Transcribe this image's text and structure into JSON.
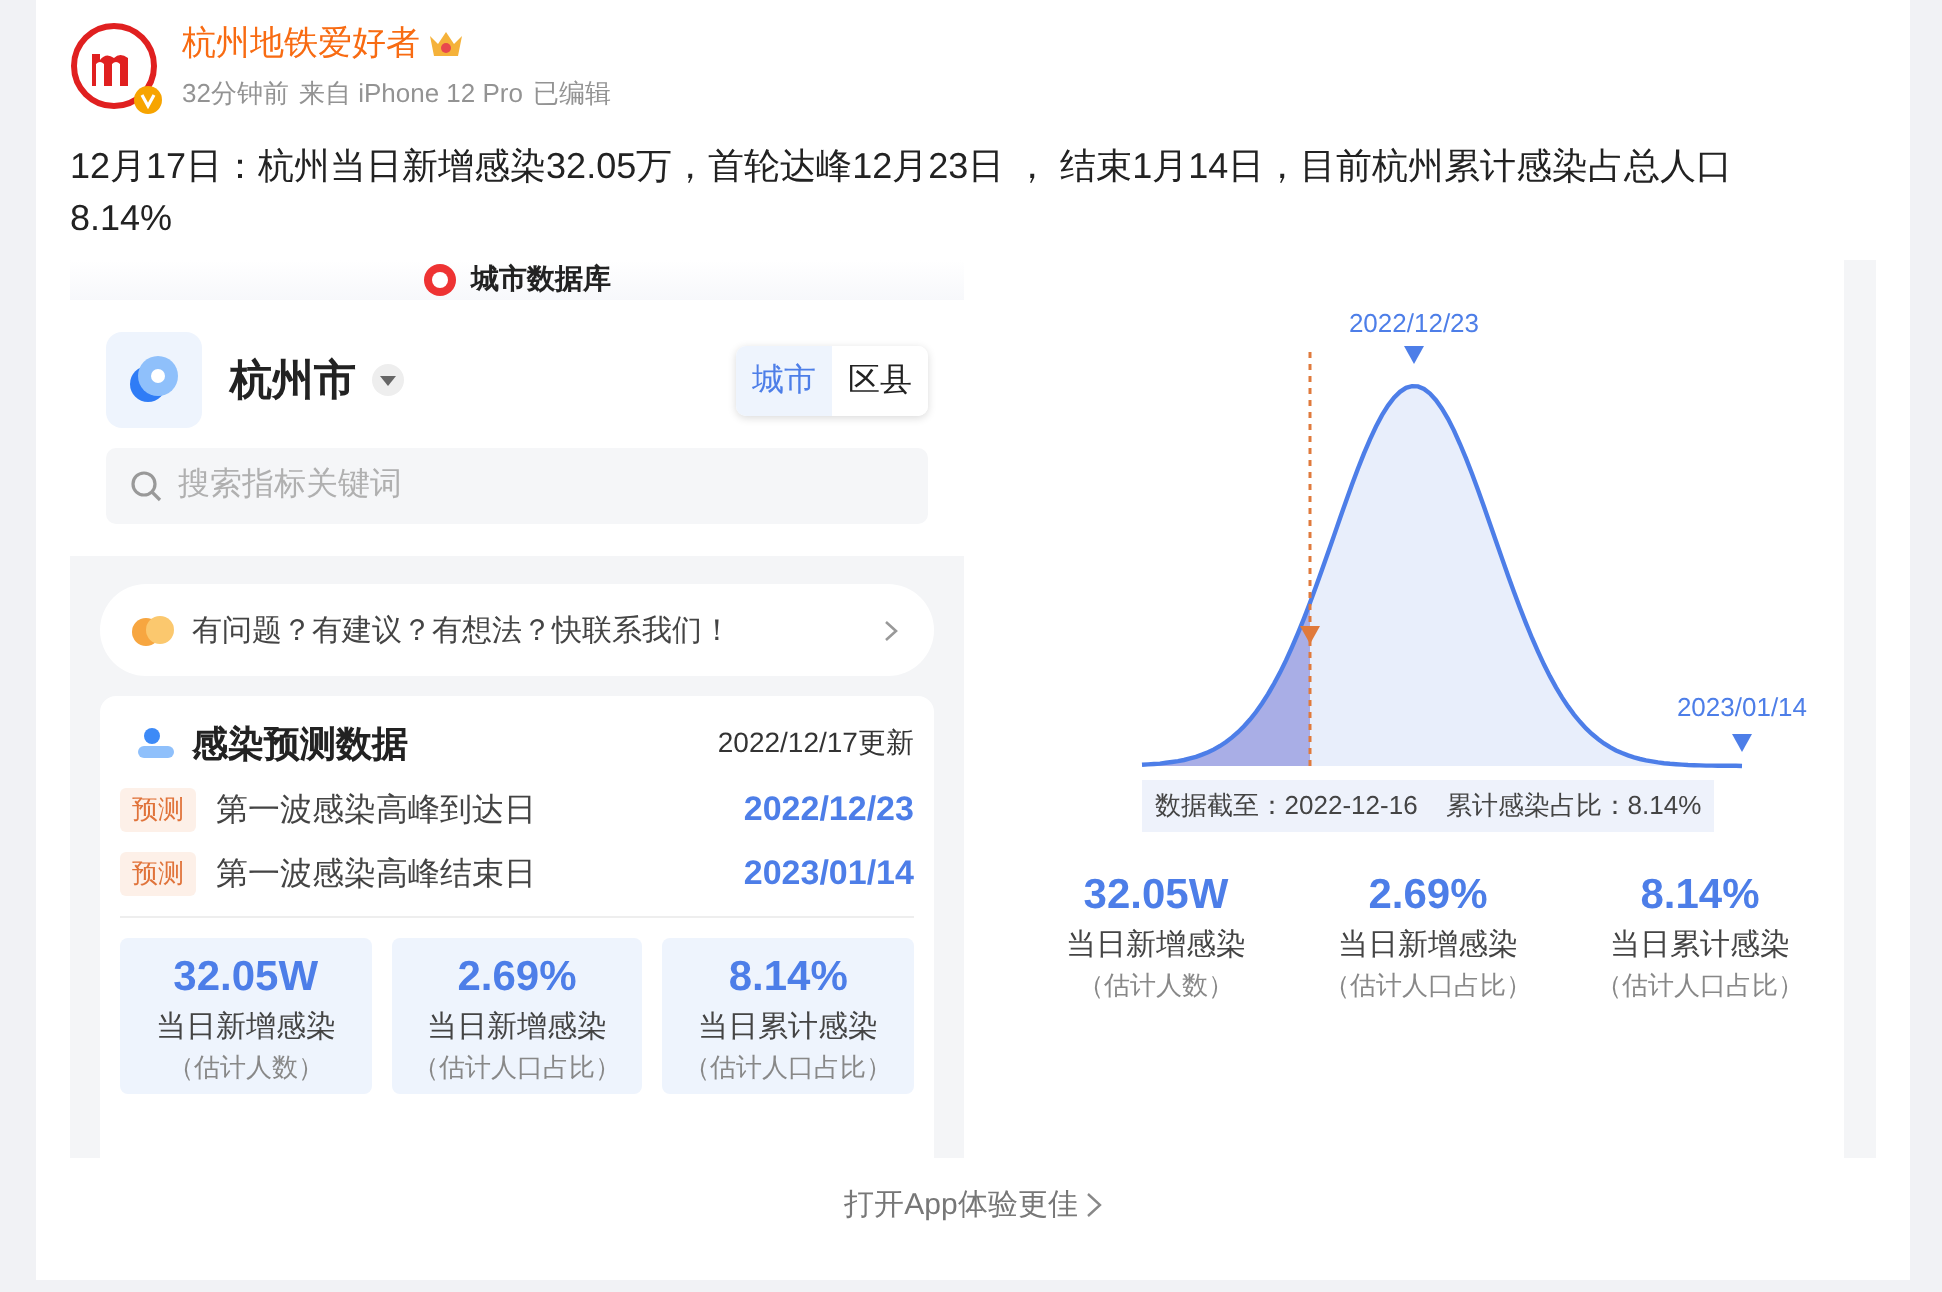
{
  "post": {
    "author": "杭州地铁爱好者",
    "time": "32分钟前",
    "source": "来自 iPhone 12 Pro",
    "edited": "已编辑",
    "text": "12月17日：杭州当日新增感染32.05万，首轮达峰12月23日 ， 结束1月14日，目前杭州累计感染占总人口8.14%"
  },
  "left_image": {
    "app_title": "城市数据库",
    "city": "杭州市",
    "scope_tabs": [
      {
        "label": "城市",
        "selected": true
      },
      {
        "label": "区县",
        "selected": false
      }
    ],
    "search": {
      "placeholder": "搜索指标关键词"
    },
    "feedback_banner": "有问题？有建议？有想法？快联系我们！",
    "card": {
      "title": "感染预测数据",
      "updated": "2022/12/17更新",
      "predictions": [
        {
          "tag": "预测",
          "label": "第一波感染高峰到达日",
          "date": "2022/12/23"
        },
        {
          "tag": "预测",
          "label": "第一波感染高峰结束日",
          "date": "2023/01/14"
        }
      ],
      "stats": [
        {
          "value": "32.05W",
          "label": "当日新增感染",
          "note": "（估计人数）"
        },
        {
          "value": "2.69%",
          "label": "当日新增感染",
          "note": "（估计人口占比）"
        },
        {
          "value": "8.14%",
          "label": "当日累计感染",
          "note": "（估计人口占比）"
        }
      ]
    }
  },
  "right_image": {
    "peak_label": "2022/12/23",
    "end_label": "2023/01/14",
    "data_date": "数据截至：2022-12-16",
    "cumulative": "累计感染占比：8.14%",
    "stats": [
      {
        "value": "32.05W",
        "label": "当日新增感染",
        "note": "（估计人数）"
      },
      {
        "value": "2.69%",
        "label": "当日新增感染",
        "note": "（估计人口占比）"
      },
      {
        "value": "8.14%",
        "label": "当日累计感染",
        "note": "（估计人口占比）"
      }
    ]
  },
  "footer_link": "打开App体验更佳"
}
